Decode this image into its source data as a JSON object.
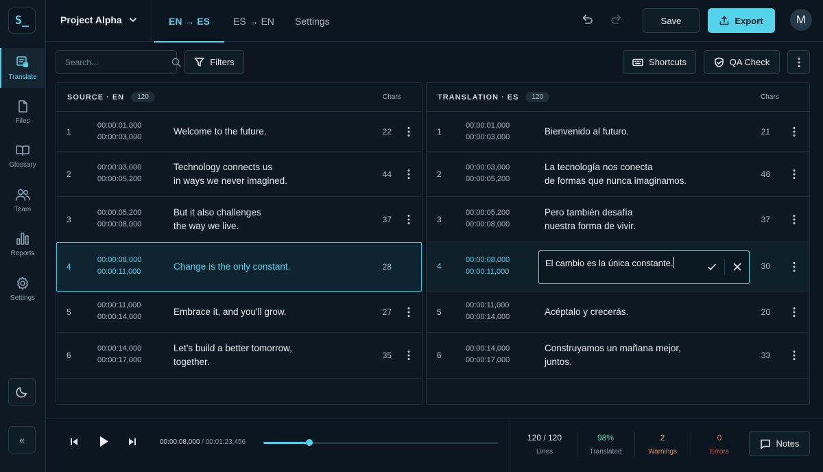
{
  "app": {
    "logo_text": "S_",
    "project_name": "Project Alpha",
    "colors": {
      "accent": "#4fd3e8",
      "background": "#0b1620",
      "warning": "#e3a35a",
      "error": "#e06b5a",
      "success": "#4fd3a8"
    }
  },
  "sidebar": {
    "items": [
      {
        "label": "Translate",
        "icon": "translate-icon",
        "active": true
      },
      {
        "label": "Files",
        "icon": "file-icon"
      },
      {
        "label": "Glossary",
        "icon": "book-icon"
      },
      {
        "label": "Team",
        "icon": "team-icon"
      },
      {
        "label": "Reports",
        "icon": "bar-chart-icon"
      },
      {
        "label": "Settings",
        "icon": "gear-icon"
      }
    ],
    "theme_toggle_icon": "moon-icon",
    "collapse_label": "«"
  },
  "header": {
    "tabs": [
      {
        "label": "EN → ES",
        "active": true
      },
      {
        "label": "ES → EN"
      },
      {
        "label": "Settings"
      }
    ],
    "save_label": "Save",
    "export_label": "Export",
    "avatar_initial": "M"
  },
  "toolbar": {
    "search_placeholder": "Search...",
    "filters_label": "Filters",
    "shortcuts_label": "Shortcuts",
    "qa_check_label": "QA Check"
  },
  "source": {
    "title": "SOURCE · EN",
    "count": "120",
    "chars_header": "Chars",
    "rows": [
      {
        "num": "1",
        "start": "00:00:01,000",
        "end": "00:00:03,000",
        "line1": "Welcome to the future.",
        "line2": "",
        "chars": "22"
      },
      {
        "num": "2",
        "start": "00:00:03,000",
        "end": "00:00:05,200",
        "line1": "Technology connects us",
        "line2": "in ways we never imagined.",
        "chars": "44"
      },
      {
        "num": "3",
        "start": "00:00:05,200",
        "end": "00:00:08,000",
        "line1": "But it also challenges",
        "line2": "the way we live.",
        "chars": "37"
      },
      {
        "num": "4",
        "start": "00:00:08,000",
        "end": "00:00:11,000",
        "line1": "Change is the only constant.",
        "line2": "",
        "chars": "28"
      },
      {
        "num": "5",
        "start": "00:00:11,000",
        "end": "00:00:14,000",
        "line1": "Embrace it, and you'll grow.",
        "line2": "",
        "chars": "27"
      },
      {
        "num": "6",
        "start": "00:00:14,000",
        "end": "00:00:17,000",
        "line1": "Let's build a better tomorrow,",
        "line2": "together.",
        "chars": "35"
      }
    ]
  },
  "translation": {
    "title": "TRANSLATION · ES",
    "count": "120",
    "chars_header": "Chars",
    "rows": [
      {
        "num": "1",
        "start": "00:00:01,000",
        "end": "00:00:03,000",
        "line1": "Bienvenido al futuro.",
        "line2": "",
        "chars": "21"
      },
      {
        "num": "2",
        "start": "00:00:03,000",
        "end": "00:00:05,200",
        "line1": "La tecnología nos conecta",
        "line2": "de formas que nunca imaginamos.",
        "chars": "48"
      },
      {
        "num": "3",
        "start": "00:00:05,200",
        "end": "00:00:08,000",
        "line1": "Pero también desafía",
        "line2": "nuestra forma de vivir.",
        "chars": "37"
      },
      {
        "num": "4",
        "start": "00:00:08,000",
        "end": "00:00:11,000",
        "line1": "El cambio es la única constante.",
        "line2": "",
        "chars": "30"
      },
      {
        "num": "5",
        "start": "00:00:11,000",
        "end": "00:00:14,000",
        "line1": "Acéptalo y crecerás.",
        "line2": "",
        "chars": "20"
      },
      {
        "num": "6",
        "start": "00:00:14,000",
        "end": "00:00:17,000",
        "line1": "Construyamos un mañana mejor,",
        "line2": "juntos.",
        "chars": "33"
      }
    ]
  },
  "player": {
    "current_time": "00:00:08,000",
    "separator": "/",
    "total_time": "00:01:23,456",
    "progress": 0.195
  },
  "stats": {
    "lines_value": "120 / 120",
    "lines_label": "Lines",
    "translated_value": "98%",
    "translated_label": "Translated",
    "warnings_value": "2",
    "warnings_label": "Warnings",
    "errors_value": "0",
    "errors_label": "Errors"
  },
  "notes_label": "Notes"
}
